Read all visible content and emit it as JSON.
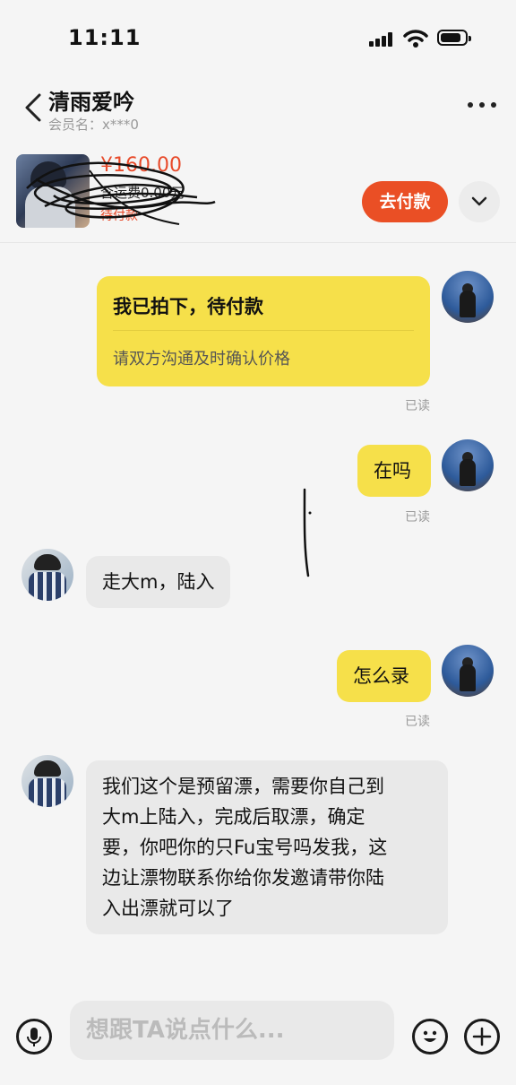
{
  "status_bar": {
    "time": "11:11"
  },
  "header": {
    "title": "清雨爱吟",
    "member_label": "会员名：x***0"
  },
  "product": {
    "price": "¥160.00",
    "shipping": "含运费0.00元",
    "status": "待付款",
    "pay_button": "去付款"
  },
  "messages": [
    {
      "side": "me",
      "card_title": "我已拍下，待付款",
      "card_sub": "请双方沟通及时确认价格",
      "read": "已读"
    },
    {
      "side": "me",
      "text": "在吗",
      "read": "已读"
    },
    {
      "side": "them",
      "text": "走大m，陆入"
    },
    {
      "side": "me",
      "text": "怎么录",
      "read": "已读"
    },
    {
      "side": "them",
      "lines": [
        "我们这个是预留漂，需要你自己到",
        "大m上陆入，完成后取漂，确定",
        "要，你吧你的只Fu宝号吗发我，这",
        "边让漂物联系你给你发邀请带你陆",
        "入出漂就可以了"
      ]
    }
  ],
  "input": {
    "placeholder": "想跟TA说点什么..."
  },
  "colors": {
    "accent_yellow": "#f6e04a",
    "pay_orange": "#ea4f25"
  },
  "icons": [
    "signal-icon",
    "wifi-icon",
    "battery-icon",
    "back-arrow-icon",
    "more-icon",
    "chevron-down-icon",
    "microphone-icon",
    "emoji-icon",
    "plus-icon"
  ]
}
